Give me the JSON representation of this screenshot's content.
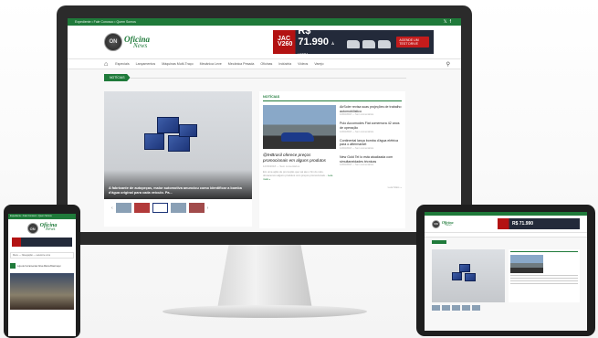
{
  "site": {
    "topbar_links": "Expediente • Fale Conosco • Quem Somos",
    "social_icons": [
      "twitter-icon",
      "facebook-icon"
    ],
    "logo_mark": "ON",
    "logo_line1": "Oficina",
    "logo_line2": "News",
    "nav_items": [
      "Especiais",
      "Lançamentos",
      "Máquinas Multi-Traço",
      "Mecânica Leve",
      "Mecânica Pesada",
      "Oficinas",
      "Indústria",
      "Vídeos",
      "Varejo"
    ],
    "ticker_label": "NOTÍCIAS"
  },
  "ad": {
    "brand": "JAC V260",
    "price": "R$ 71.990",
    "price_note": "À VISTA",
    "cta": "AGENDE UM TEST DRIVE"
  },
  "feature": {
    "caption": "A fabricante de autopeças, maior automotiva anunciou como identificar a bomba d'água original para cada veículo. Pa..."
  },
  "news": {
    "title": "NOTÍCIAS",
    "main_headline": "@IHBrasil oferece preços promocionais em alguns produtos",
    "main_meta": "12/03/2018 — Sem comentários",
    "main_excerpt": "Em uma ação de promoção que vai até o fim do mês, oferecemos alguns produtos com preços promocionais...",
    "read_more": "Leia mais »",
    "items": [
      {
        "headline": "AirSoler revisa suas projeções de trabalho automobilístico",
        "meta": "12/03/2018 — Sem comentários"
      },
      {
        "headline": "Pulo Accomodes Fiat comemora 42 anos de operação",
        "meta": "12/03/2018 — Sem comentários"
      },
      {
        "headline": "Continental lança bomba d'água elétrica para o aftermarket",
        "meta": "12/03/2018 — Sem comentários"
      },
      {
        "headline": "New Gold Tel lo está atualizada com simultaneidades técnicas",
        "meta": "12/03/2018 — Sem comentários"
      }
    ],
    "see_more": "Leia Mais »"
  },
  "phone": {
    "topbar": "Expediente • Fale Conosco • Quem Somos",
    "menu": "Menu — Navegação — selecione uma",
    "ticker_text": "Loja de Ferramentas Nova Marca Brasil aqui"
  }
}
